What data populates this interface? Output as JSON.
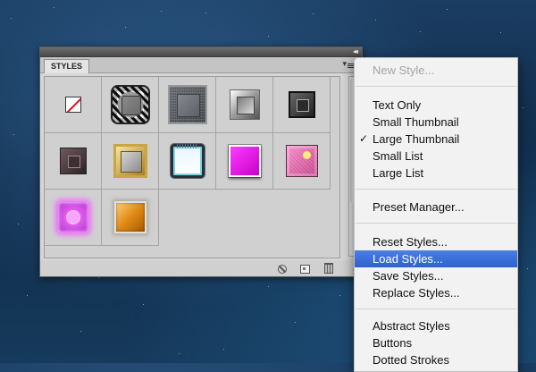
{
  "panel": {
    "tab_label": "STYLES",
    "swatches": [
      {
        "name": "no-style"
      },
      {
        "name": "striped-bevel"
      },
      {
        "name": "grain-metal"
      },
      {
        "name": "silver-bevel"
      },
      {
        "name": "dark-bevel"
      },
      {
        "name": "plum-bevel"
      },
      {
        "name": "gold-frame"
      },
      {
        "name": "ice-blue"
      },
      {
        "name": "magenta-glossy"
      },
      {
        "name": "pink-fabric"
      },
      {
        "name": "pink-glow"
      },
      {
        "name": "amber-glossy"
      }
    ]
  },
  "menu": {
    "new_style": "New Style...",
    "view_options": [
      "Text Only",
      "Small Thumbnail",
      "Large Thumbnail",
      "Small List",
      "Large List"
    ],
    "selected_view": "Large Thumbnail",
    "preset_manager": "Preset Manager...",
    "style_ops": [
      "Reset Styles...",
      "Load Styles...",
      "Save Styles...",
      "Replace Styles..."
    ],
    "highlighted_item": "Load Styles...",
    "libraries": [
      "Abstract Styles",
      "Buttons",
      "Dotted Strokes"
    ]
  },
  "icons": {
    "checkmark": "✓",
    "panel_collapse": "◂◂",
    "panel_menu": "▾"
  }
}
